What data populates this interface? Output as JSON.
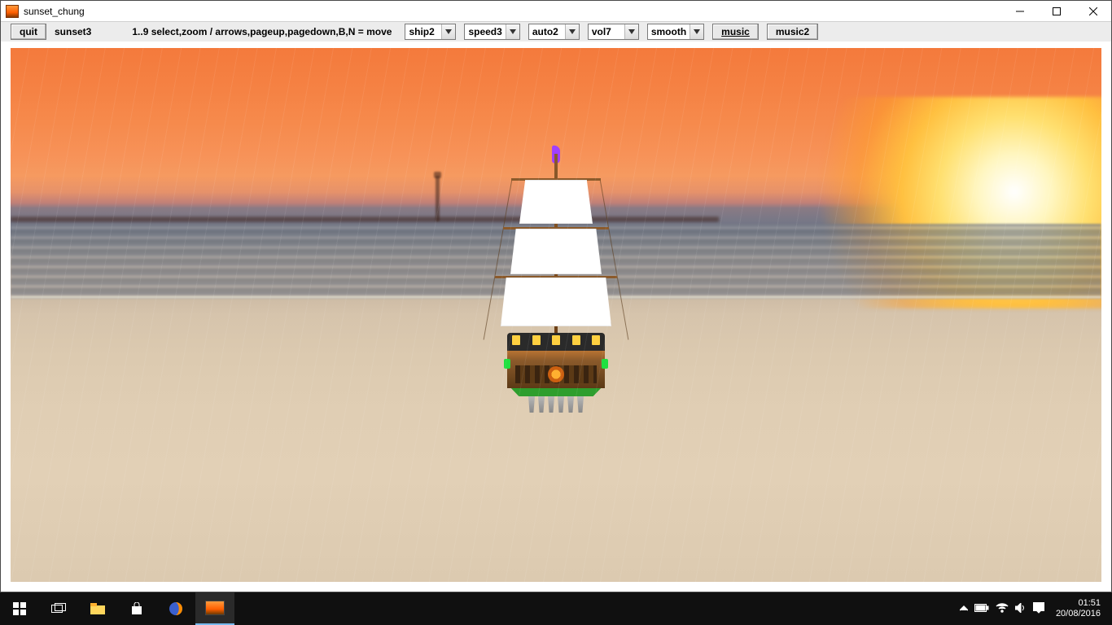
{
  "window": {
    "title": "sunset_chung"
  },
  "toolbar": {
    "quit_label": "quit",
    "status_label": "sunset3",
    "hint_label": "1..9 select,zoom / arrows,pageup,pagedown,B,N = move",
    "ship_dropdown": "ship2",
    "speed_dropdown": "speed3",
    "auto_dropdown": "auto2",
    "vol_dropdown": "vol7",
    "smooth_dropdown": "smooth",
    "music_button": "music",
    "music2_button": "music2"
  },
  "taskbar": {
    "time": "01:51",
    "date": "20/08/2016"
  }
}
